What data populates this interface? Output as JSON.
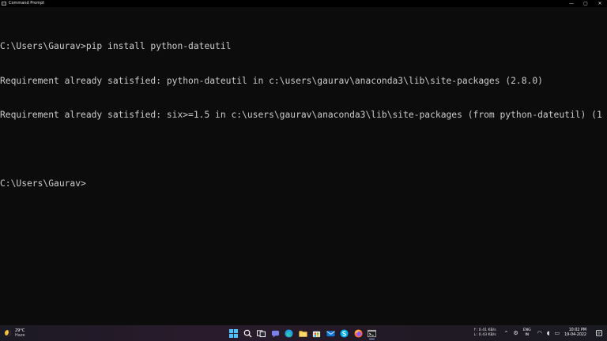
{
  "window": {
    "title": "Command Prompt",
    "controls": {
      "minimize": "—",
      "maximize": "▢",
      "close": "✕"
    }
  },
  "console": {
    "lines": [
      "C:\\Users\\Gaurav>pip install python-dateutil",
      "Requirement already satisfied: python-dateutil in c:\\users\\gaurav\\anaconda3\\lib\\site-packages (2.8.0)",
      "Requirement already satisfied: six>=1.5 in c:\\users\\gaurav\\anaconda3\\lib\\site-packages (from python-dateutil) (1",
      "",
      "C:\\Users\\Gaurav>"
    ]
  },
  "taskbar": {
    "weather": {
      "temp": "29°C",
      "condition": "Haze"
    },
    "apps": [
      {
        "name": "start-button",
        "icon": "windows-logo-icon"
      },
      {
        "name": "search-button",
        "icon": "search-icon"
      },
      {
        "name": "task-view-button",
        "icon": "task-view-icon"
      },
      {
        "name": "chat-button",
        "icon": "chat-icon"
      },
      {
        "name": "edge-button",
        "icon": "edge-icon"
      },
      {
        "name": "file-explorer-button",
        "icon": "folder-icon"
      },
      {
        "name": "store-button",
        "icon": "store-icon"
      },
      {
        "name": "mail-button",
        "icon": "mail-icon"
      },
      {
        "name": "skype-button",
        "icon": "skype-icon"
      },
      {
        "name": "firefox-button",
        "icon": "firefox-icon"
      },
      {
        "name": "terminal-button",
        "icon": "terminal-icon"
      }
    ],
    "tray": {
      "upload_speed": "↑: 0.41 KB/s",
      "download_speed": "↓: 0.43 KB/s",
      "language": "ENG",
      "region": "IN",
      "time": "10:02 PM",
      "date": "19-04-2022"
    }
  },
  "colors": {
    "console_bg": "#0c0c0c",
    "console_text": "#cccccc",
    "titlebar_bg": "#000000"
  }
}
